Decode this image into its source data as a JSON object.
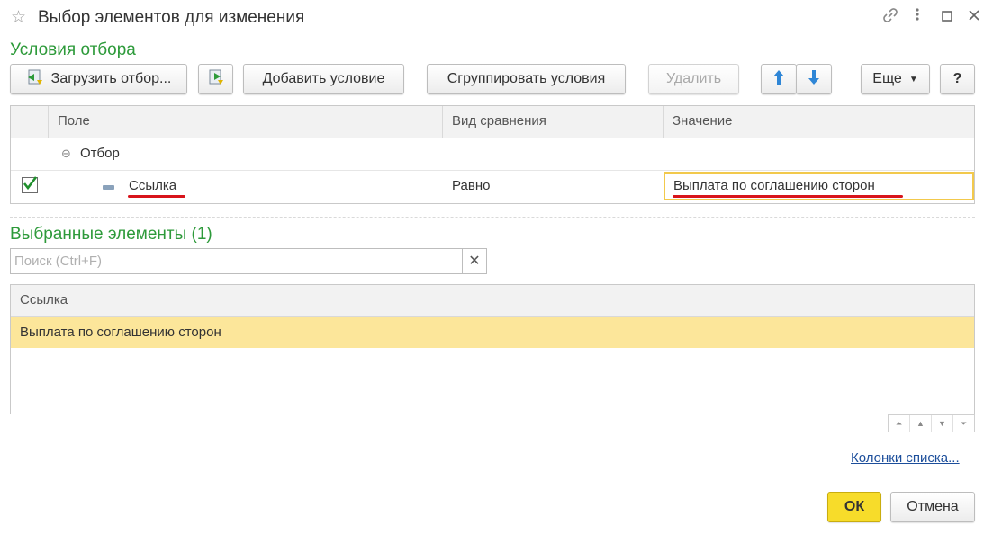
{
  "window": {
    "title": "Выбор элементов для изменения",
    "controls": {
      "link_icon": "link-icon",
      "more_icon": "more-icon",
      "maximize_icon": "maximize-icon",
      "close_icon": "close-icon"
    }
  },
  "filter_section": {
    "title": "Условия отбора",
    "toolbar": {
      "load_filter": "Загрузить отбор...",
      "add_condition": "Добавить условие",
      "group_conditions": "Сгруппировать условия",
      "delete": "Удалить",
      "more": "Еще",
      "help": "?"
    },
    "columns": [
      "Поле",
      "Вид сравнения",
      "Значение"
    ],
    "group_row": {
      "label": "Отбор"
    },
    "condition_row": {
      "checked": true,
      "field": "Ссылка",
      "comparison": "Равно",
      "value": "Выплата по соглашению сторон"
    }
  },
  "selected_section": {
    "title": "Выбранные элементы (1)",
    "search_placeholder": "Поиск (Ctrl+F)",
    "column": "Ссылка",
    "rows": [
      "Выплата по соглашению сторон"
    ],
    "columns_link": "Колонки списка..."
  },
  "footer": {
    "ok": "ОК",
    "cancel": "Отмена"
  },
  "colors": {
    "section_title": "#2d9a3a",
    "selected_row": "#fce69a",
    "ok_button": "#f7dc2a",
    "underline": "#d8141b",
    "link": "#1c4e9b"
  }
}
